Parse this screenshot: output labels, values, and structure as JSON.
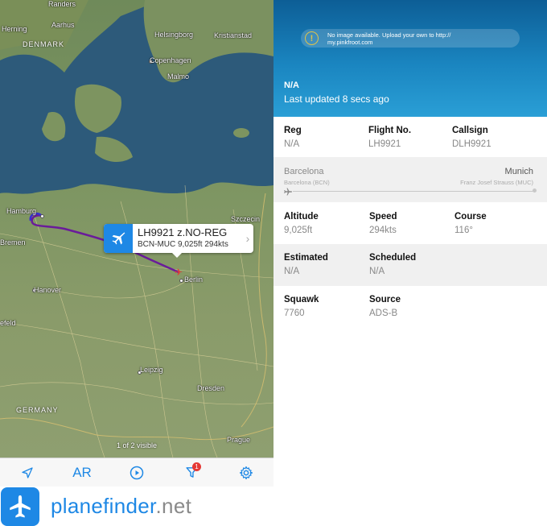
{
  "map": {
    "cities": [
      "Randers",
      "Aarhus",
      "Herning",
      "DENMARK",
      "Helsingborg",
      "Kristianstad",
      "Copenhagen",
      "Malmo",
      "Hamburg",
      "Szczecin",
      "Bremen",
      "Hanover",
      "Berlin",
      "efeld",
      "Leipzig",
      "Dresden",
      "GERMANY",
      "Prague"
    ],
    "visible_count": "1 of 2 visible",
    "callout": {
      "title": "LH9921 z.NO-REG",
      "subtitle": "BCN-MUC 9,025ft 294kts"
    }
  },
  "toolbar": {
    "locate_icon": "location-arrow-icon",
    "ar_label": "AR",
    "play_icon": "play-circle-icon",
    "filter_icon": "filter-icon",
    "filter_badge": "1",
    "settings_icon": "gear-icon"
  },
  "brand": {
    "name": "planefinder",
    "tld": ".net"
  },
  "details": {
    "no_image_message": "No image available. Upload your own to http://",
    "no_image_link": "my.pinkfroot.com",
    "aircraft": "N/A",
    "last_updated": "Last updated 8 secs ago",
    "reg_label": "Reg",
    "reg_value": "N/A",
    "flight_label": "Flight No.",
    "flight_value": "LH9921",
    "callsign_label": "Callsign",
    "callsign_value": "DLH9921",
    "route": {
      "from": "Barcelona",
      "from_airport": "Barcelona (BCN)",
      "to": "Munich",
      "to_airport": "Franz Josef Strauss (MUC)"
    },
    "altitude_label": "Altitude",
    "altitude_value": "9,025ft",
    "speed_label": "Speed",
    "speed_value": "294kts",
    "course_label": "Course",
    "course_value": "116°",
    "estimated_label": "Estimated",
    "estimated_value": "N/A",
    "scheduled_label": "Scheduled",
    "scheduled_value": "N/A",
    "squawk_label": "Squawk",
    "squawk_value": "7760",
    "source_label": "Source",
    "source_value": "ADS-B"
  },
  "colors": {
    "accent": "#1e88e5",
    "track": "#6a1b9a",
    "hero_top": "#0d5e96",
    "hero_bottom": "#2a9fd6"
  }
}
